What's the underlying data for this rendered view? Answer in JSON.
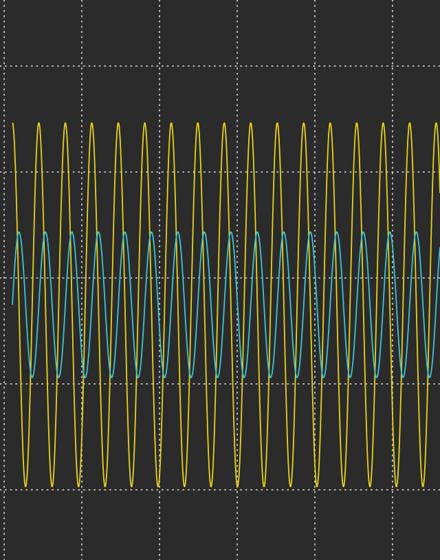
{
  "chart_data": {
    "type": "line",
    "title": "",
    "xlabel": "",
    "ylabel": "",
    "grid": true,
    "legend": "none",
    "xlim": [
      0,
      10
    ],
    "ylim": [
      -4,
      4
    ],
    "grid_divisions": {
      "x": 10,
      "y": 8
    },
    "series": [
      {
        "color": "#e8d31c",
        "amplitude": 2.5,
        "offset": 0,
        "cycles_per_division": 1.765,
        "phase_deg": 90
      },
      {
        "color": "#3fc4d2",
        "amplitude": 1.0,
        "offset": 0,
        "cycles_per_division": 1.765,
        "phase_deg": 0
      }
    ]
  },
  "colors": {
    "background": "#2b2b2b",
    "grid": "#d8d8d8"
  }
}
